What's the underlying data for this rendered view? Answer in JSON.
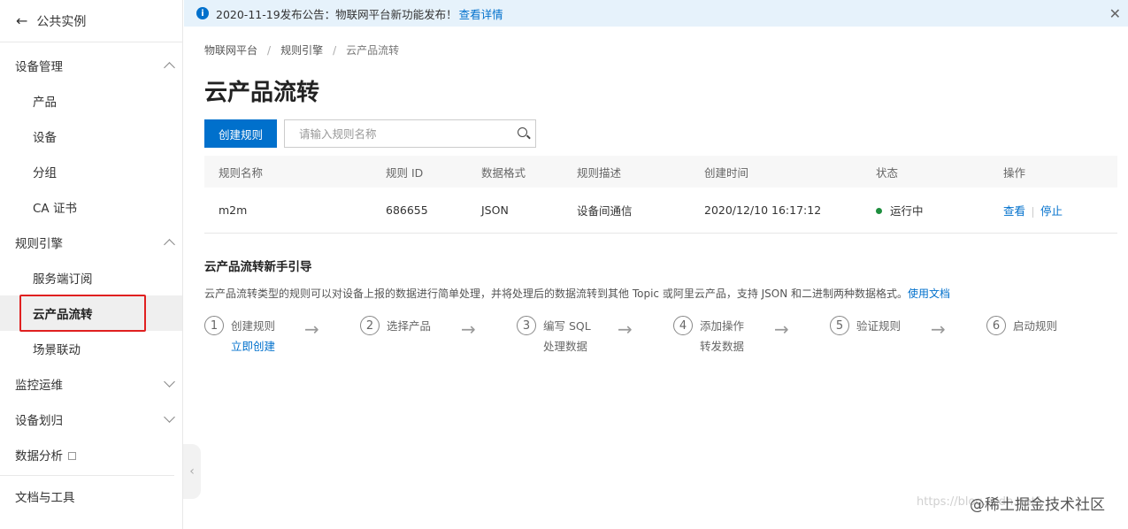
{
  "sidebar": {
    "back_label": "公共实例",
    "groups": [
      {
        "label": "设备管理",
        "items": [
          "产品",
          "设备",
          "分组",
          "CA 证书"
        ]
      },
      {
        "label": "规则引擎",
        "items": [
          "服务端订阅",
          "云产品流转",
          "场景联动"
        ]
      },
      {
        "label": "监控运维"
      },
      {
        "label": "设备划归"
      },
      {
        "label": "数据分析"
      },
      {
        "label": "文档与工具"
      }
    ]
  },
  "notice": {
    "text": "2020-11-19发布公告：物联网平台新功能发布！",
    "link": "查看详情"
  },
  "breadcrumb": [
    "物联网平台",
    "规则引擎",
    "云产品流转"
  ],
  "page_title": "云产品流转",
  "toolbar": {
    "create_label": "创建规则",
    "search_placeholder": "请输入规则名称"
  },
  "table": {
    "headers": [
      "规则名称",
      "规则 ID",
      "数据格式",
      "规则描述",
      "创建时间",
      "状态",
      "操作"
    ],
    "rows": [
      {
        "name": "m2m",
        "id": "686655",
        "format": "JSON",
        "desc": "设备间通信",
        "created": "2020/12/10 16:17:12",
        "status": "运行中",
        "action_view": "查看",
        "action_stop": "停止"
      }
    ]
  },
  "guide": {
    "title": "云产品流转新手引导",
    "desc": "云产品流转类型的规则可以对设备上报的数据进行简单处理，并将处理后的数据流转到其他 Topic 或阿里云产品，支持 JSON 和二进制两种数据格式。",
    "desc_link": "使用文档",
    "steps": [
      {
        "num": "1",
        "label": "创建规则",
        "sub": "立即创建"
      },
      {
        "num": "2",
        "label": "选择产品",
        "sub": ""
      },
      {
        "num": "3",
        "label": "编写 SQL",
        "sub": "处理数据"
      },
      {
        "num": "4",
        "label": "添加操作",
        "sub": "转发数据"
      },
      {
        "num": "5",
        "label": "验证规则",
        "sub": ""
      },
      {
        "num": "6",
        "label": "启动规则",
        "sub": ""
      }
    ]
  },
  "watermark": {
    "brand": "@稀土掘金技术社区",
    "url": "https://blog.csdn.net/"
  },
  "colors": {
    "accent": "#0070cc",
    "notice_bg": "#e6f2fb",
    "status_ok": "#1e8e3e",
    "highlight": "#e02020"
  }
}
